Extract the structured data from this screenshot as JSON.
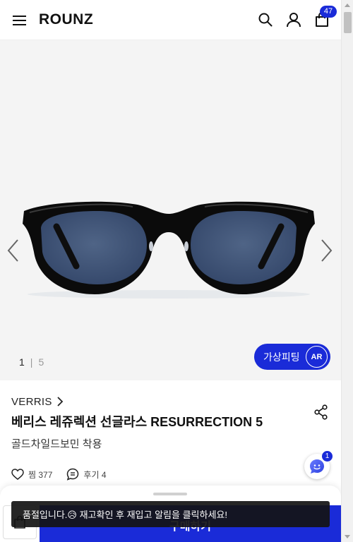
{
  "header": {
    "logo": "ROUNZ",
    "cart_count": "47"
  },
  "icons": {
    "menu": "hamburger-icon",
    "search": "search-icon",
    "account": "user-icon",
    "cart": "shopping-bag-icon",
    "share": "share-icon",
    "like": "heart-icon",
    "review": "chat-icon",
    "chatbot": "chatbot-icon"
  },
  "gallery": {
    "current_page": "1",
    "total_pages": "5",
    "ar_button_label": "가상피팅",
    "ar_badge": "AR"
  },
  "product": {
    "brand": "VERRIS",
    "name": "베리스 레쥬렉션 선글라스 RESURRECTION 5",
    "color": "골드차일드보민 착용",
    "likes_label": "찜 377",
    "reviews_label": "후기 4"
  },
  "chatbot": {
    "badge": "1"
  },
  "bottom_bar": {
    "buy_label": "구매하기"
  },
  "toast": {
    "message": "품절입니다.😥 재고확인 후 재입고 알림을 클릭하세요!"
  },
  "colors": {
    "accent": "#1a2bd8",
    "gallery_bg": "#f4f4f4"
  }
}
